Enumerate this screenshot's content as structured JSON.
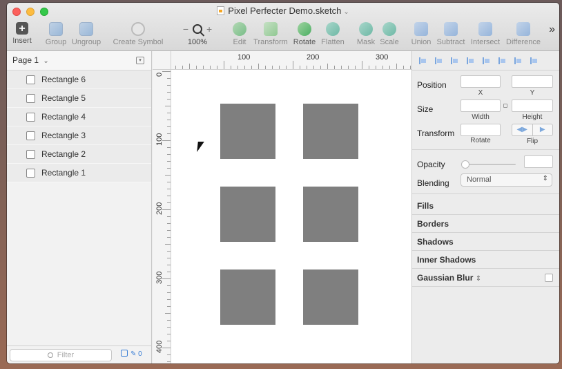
{
  "window": {
    "title": "Pixel Perfecter Demo.sketch"
  },
  "toolbar": {
    "insert": "Insert",
    "group": "Group",
    "ungroup": "Ungroup",
    "create_symbol": "Create Symbol",
    "zoom_level": "100%",
    "zoom_minus": "−",
    "zoom_plus": "+",
    "edit": "Edit",
    "transform": "Transform",
    "rotate": "Rotate",
    "flatten": "Flatten",
    "mask": "Mask",
    "scale": "Scale",
    "union": "Union",
    "subtract": "Subtract",
    "intersect": "Intersect",
    "difference": "Difference",
    "more": "»"
  },
  "sidebar": {
    "page": "Page 1",
    "layers": [
      "Rectangle 6",
      "Rectangle 5",
      "Rectangle 4",
      "Rectangle 3",
      "Rectangle 2",
      "Rectangle 1"
    ],
    "filter_placeholder": "Filter",
    "footer_count": "0"
  },
  "rulers": {
    "horizontal_labels": [
      "100",
      "200",
      "300"
    ],
    "vertical_labels": [
      "0",
      "100",
      "200",
      "300",
      "400"
    ]
  },
  "inspector": {
    "position": "Position",
    "x": "X",
    "y": "Y",
    "size": "Size",
    "width": "Width",
    "height": "Height",
    "transform": "Transform",
    "rotate": "Rotate",
    "flip": "Flip",
    "opacity": "Opacity",
    "blending": "Blending",
    "blending_value": "Normal",
    "fills": "Fills",
    "borders": "Borders",
    "shadows": "Shadows",
    "inner_shadows": "Inner Shadows",
    "gaussian_blur": "Gaussian Blur"
  },
  "colors": {
    "rectangle_fill": "#7f7f7f",
    "accent": "#3b7fd6"
  }
}
